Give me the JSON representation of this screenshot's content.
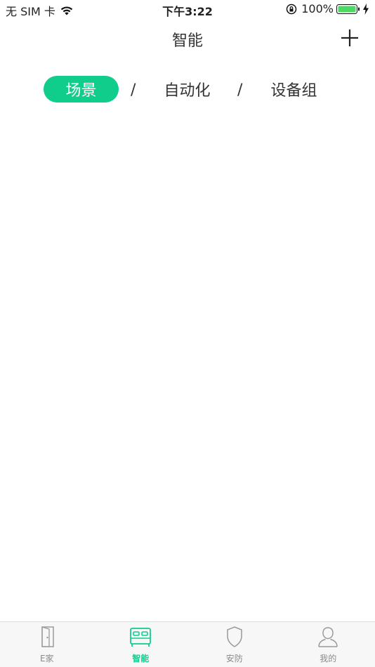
{
  "status_bar": {
    "carrier": "无 SIM 卡",
    "time": "下午3:22",
    "battery": "100%"
  },
  "header": {
    "title": "智能"
  },
  "segments": [
    {
      "label": "场景",
      "active": true
    },
    {
      "label": "自动化",
      "active": false
    },
    {
      "label": "设备组",
      "active": false
    }
  ],
  "segment_separator": "/",
  "tabbar": {
    "items": [
      {
        "label": "E家",
        "icon": "door-icon",
        "active": false
      },
      {
        "label": "智能",
        "icon": "bed-icon",
        "active": true
      },
      {
        "label": "安防",
        "icon": "shield-icon",
        "active": false
      },
      {
        "label": "我的",
        "icon": "user-icon",
        "active": false
      }
    ]
  },
  "colors": {
    "accent": "#10cd8c",
    "inactive": "#8a8a8a",
    "battery": "#4cd964"
  }
}
